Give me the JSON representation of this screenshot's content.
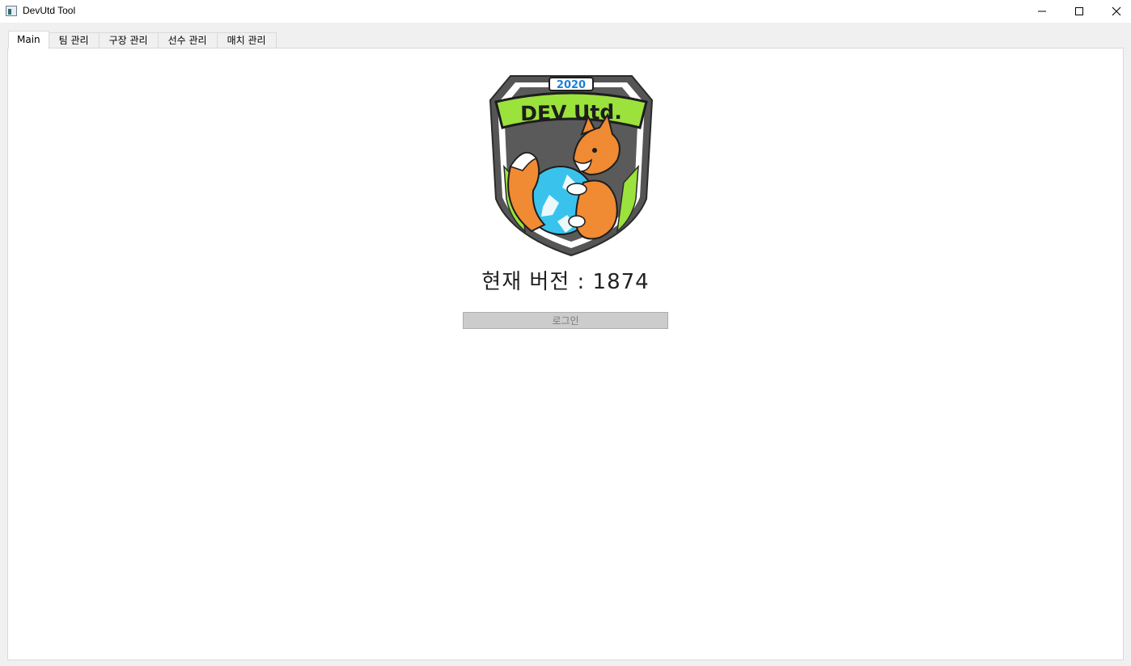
{
  "window": {
    "title": "DevUtd Tool",
    "icons": {
      "app": "app-window-icon",
      "minimize": "minimize-icon",
      "maximize": "maximize-icon",
      "close": "close-icon"
    }
  },
  "tabs": [
    {
      "label": "Main",
      "active": true
    },
    {
      "label": "팀 관리",
      "active": false
    },
    {
      "label": "구장 관리",
      "active": false
    },
    {
      "label": "선수 관리",
      "active": false
    },
    {
      "label": "매치 관리",
      "active": false
    }
  ],
  "main": {
    "logo": {
      "year": "2020",
      "name": "DEV Utd."
    },
    "version_text": "현재 버전 : 1874",
    "login_label": "로그인",
    "login_enabled": false
  },
  "colors": {
    "logo_green": "#9be23c",
    "logo_dark": "#555555",
    "fox_orange": "#f08a33",
    "ball_cyan": "#39c3ec",
    "year_blue": "#1e7fd8"
  }
}
